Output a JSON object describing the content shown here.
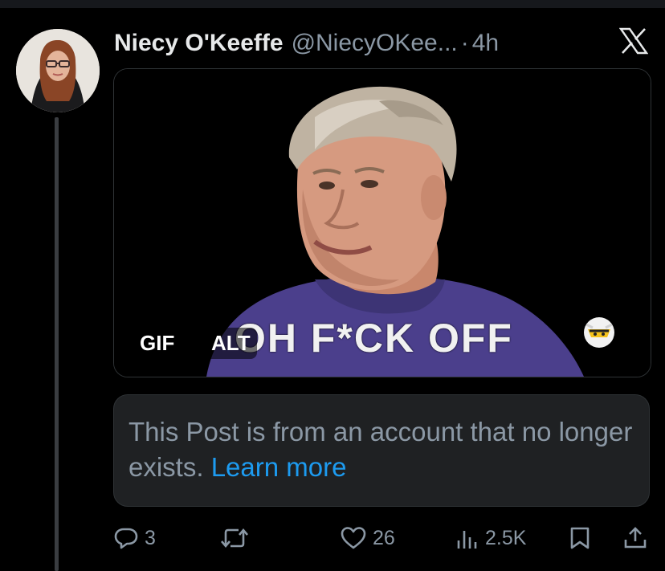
{
  "post": {
    "author_name": "Niecy O'Keeffe",
    "author_handle": "@NiecyOKee...",
    "separator": "·",
    "time": "4h"
  },
  "media": {
    "caption": "OH F*CK OFF",
    "gif_label": "GIF",
    "alt_label": "ALT"
  },
  "notice": {
    "text": "This Post is from an account that no longer exists.",
    "link_text": "Learn more"
  },
  "actions": {
    "replies": "3",
    "reposts": "",
    "likes": "26",
    "views": "2.5K"
  },
  "icons": [
    "x-logo-icon",
    "reply-icon",
    "repost-icon",
    "like-icon",
    "views-icon",
    "bookmark-icon",
    "share-icon"
  ],
  "colors": {
    "background": "#000000",
    "text": "#e7e9ea",
    "muted": "#8b98a5",
    "link": "#1d9bf0",
    "border": "#2f3336",
    "notice_bg": "#1f2123"
  }
}
